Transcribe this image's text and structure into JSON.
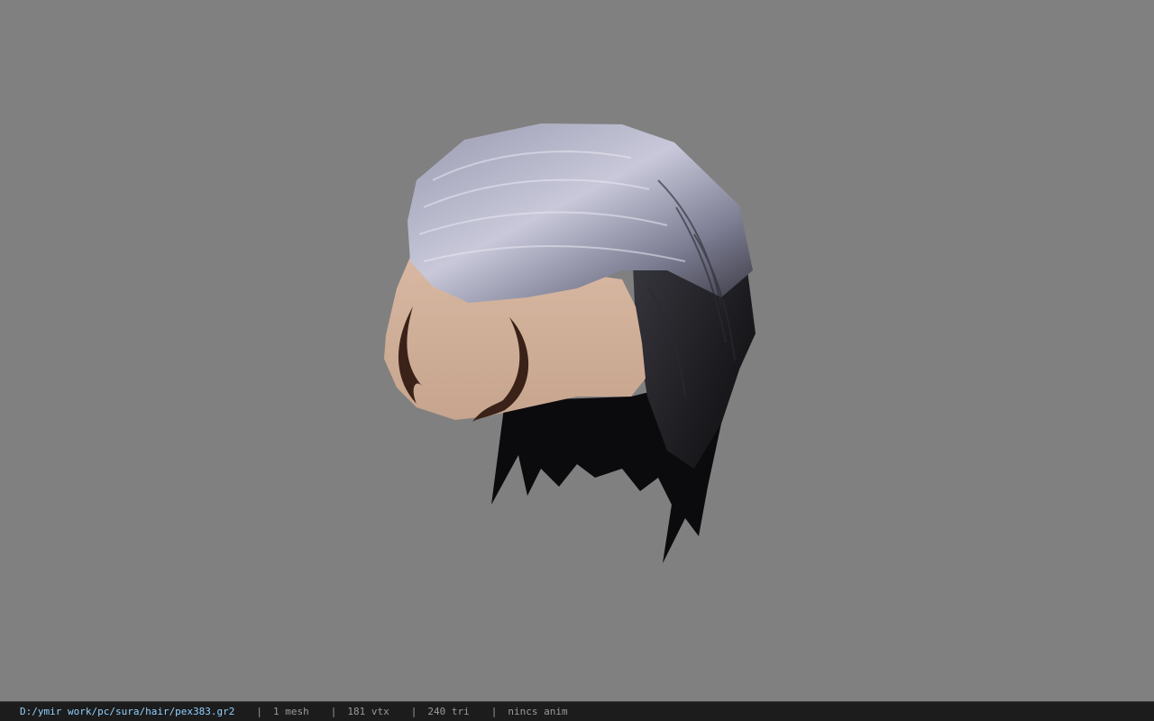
{
  "viewer": {
    "background_color": "#808080"
  },
  "model": {
    "icon": "hair-mesh-3d-preview"
  },
  "statusbar": {
    "file_path": "D:/ymir work/pc/sura/hair/pex383.gr2",
    "mesh_count": "1 mesh",
    "vertex_count": "181 vtx",
    "triangle_count": "240 tri",
    "animation": "nincs anim",
    "separator": "|",
    "path_color": "#8fd0ff"
  }
}
